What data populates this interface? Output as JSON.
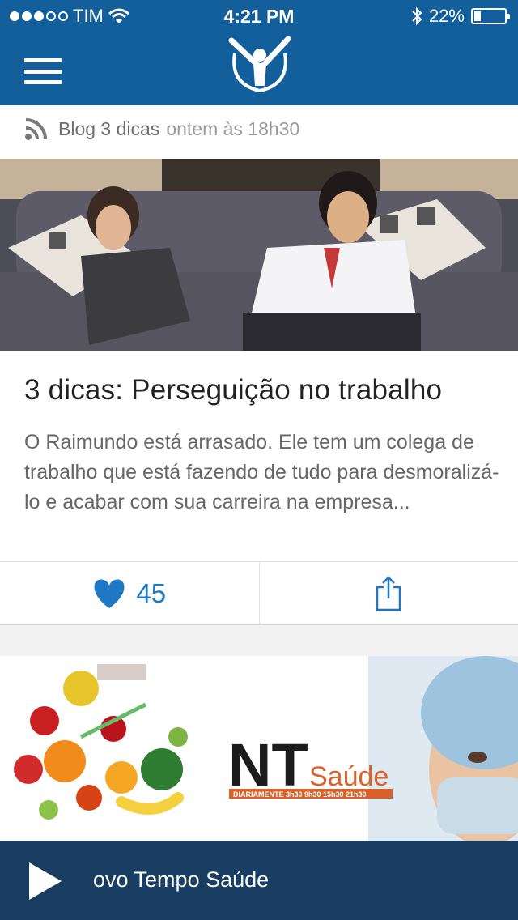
{
  "status_bar": {
    "carrier": "TIM",
    "time": "4:21 PM",
    "battery": "22%",
    "battery_level": 0.22
  },
  "header": {
    "menu_icon": "hamburger-menu-icon",
    "logo_icon": "app-logo-icon"
  },
  "post": {
    "source": "Blog 3 dicas",
    "time": "ontem às 18h30",
    "title": "3 dicas: Perseguição no trabalho",
    "summary": "O Raimundo está arrasado. Ele tem um colega de trabalho que está fazendo de tudo para desmoralizá-lo e acabar com sua carreira na empresa...",
    "likes": "45",
    "like_icon": "heart-icon",
    "share_icon": "share-icon"
  },
  "banner": {
    "brand_main": "NT",
    "brand_sub": "Saúde",
    "schedule": "DIARIAMENTE 3h30 9h30 15h30 21h30"
  },
  "player": {
    "title": "ovo Tempo Saúde",
    "play_icon": "play-icon"
  },
  "colors": {
    "header": "#135f9c",
    "accent": "#1f78c4",
    "player": "#0e3458"
  }
}
